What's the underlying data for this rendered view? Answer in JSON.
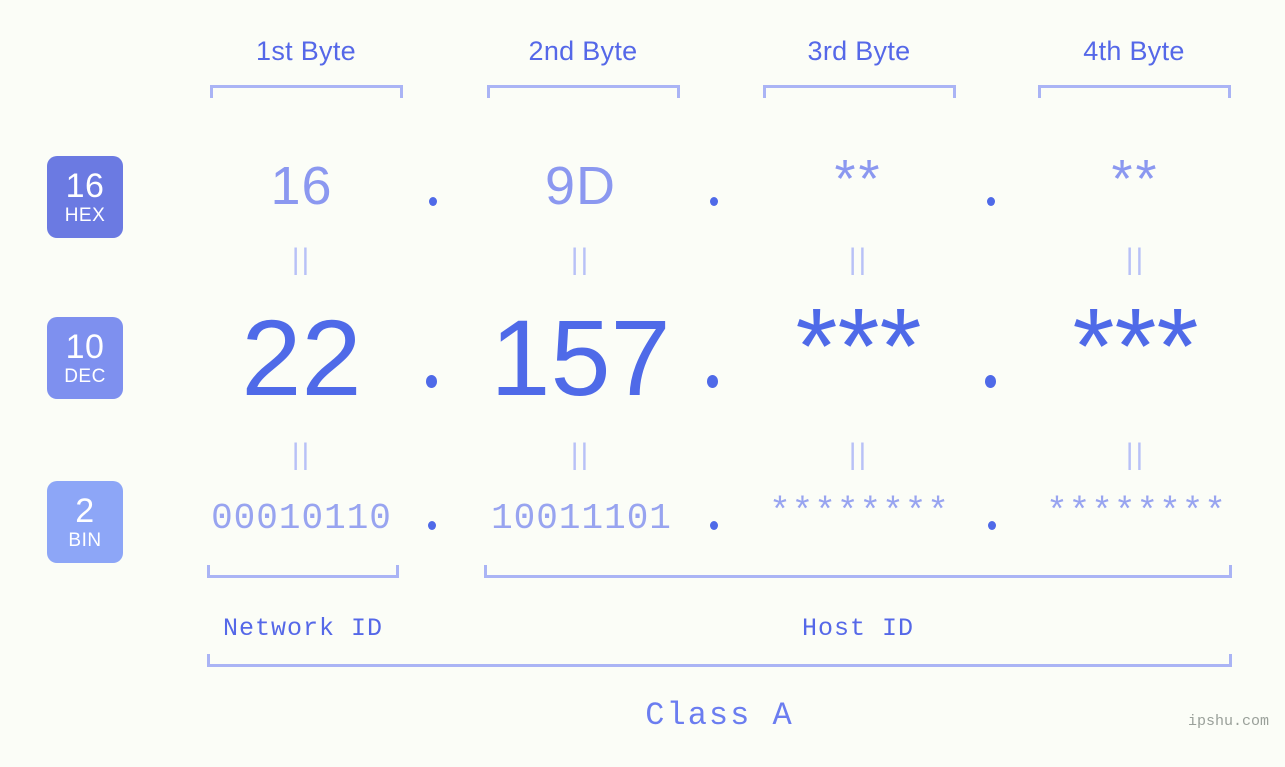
{
  "page": {
    "background_color": "#fbfdf7",
    "accent_color": "#4f6ae8",
    "muted_accent_color": "#8b98f0",
    "bracket_color": "#aab4f5"
  },
  "byte_headers": [
    {
      "label": "1st Byte"
    },
    {
      "label": "2nd Byte"
    },
    {
      "label": "3rd Byte"
    },
    {
      "label": "4th Byte"
    }
  ],
  "bases": [
    {
      "num": "16",
      "abbr": "HEX",
      "color": "#6b7ae2"
    },
    {
      "num": "10",
      "abbr": "DEC",
      "color": "#7e90ef"
    },
    {
      "num": "2",
      "abbr": "BIN",
      "color": "#8da6f7"
    }
  ],
  "rows": {
    "hex": {
      "values": [
        "16",
        "9D",
        "**",
        "**"
      ],
      "separator": "."
    },
    "dec": {
      "values": [
        "22",
        "157",
        "***",
        "***"
      ],
      "separator": "."
    },
    "bin": {
      "values": [
        "00010110",
        "10011101",
        "********",
        "********"
      ],
      "separator": "."
    }
  },
  "equals_marks": {
    "glyph": "||",
    "count_per_row": 4
  },
  "segments": {
    "network_id": "Network ID",
    "host_id": "Host ID"
  },
  "class_label": "Class A",
  "watermark": "ipshu.com"
}
